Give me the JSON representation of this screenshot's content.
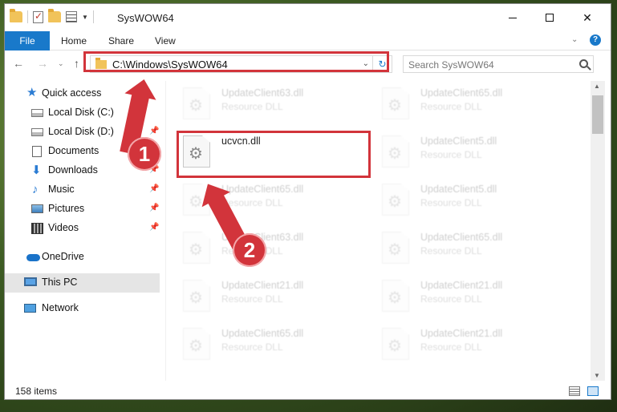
{
  "window": {
    "title": "SysWOW64"
  },
  "ribbon": {
    "tabs": [
      "File",
      "Home",
      "Share",
      "View"
    ],
    "help_label": "?"
  },
  "nav": {
    "address": "C:\\Windows\\SysWOW64",
    "search_placeholder": "Search SysWOW64"
  },
  "sidebar": {
    "items": [
      {
        "label": "Quick access",
        "icon": "star-icon"
      },
      {
        "label": "Local Disk (C:)",
        "icon": "disk-icon"
      },
      {
        "label": "Local Disk (D:)",
        "icon": "disk-icon"
      },
      {
        "label": "Documents",
        "icon": "documents-icon"
      },
      {
        "label": "Downloads",
        "icon": "download-icon"
      },
      {
        "label": "Music",
        "icon": "music-icon"
      },
      {
        "label": "Pictures",
        "icon": "pictures-icon"
      },
      {
        "label": "Videos",
        "icon": "videos-icon"
      },
      {
        "label": "OneDrive",
        "icon": "cloud-icon"
      },
      {
        "label": "This PC",
        "icon": "pc-icon"
      },
      {
        "label": "Network",
        "icon": "network-icon"
      }
    ]
  },
  "files": {
    "left": [
      {
        "name": "UpdateClient63.dll",
        "type": "Resource DLL"
      },
      {
        "name": "ucvcn.dll",
        "type": ""
      },
      {
        "name": "UpdateClient65.dll",
        "type": "Resource DLL"
      },
      {
        "name": "UpdateClient63.dll",
        "type": "Resource DLL"
      },
      {
        "name": "UpdateClient21.dll",
        "type": "Resource DLL"
      },
      {
        "name": "UpdateClient65.dll",
        "type": "Resource DLL"
      }
    ],
    "right": [
      {
        "name": "UpdateClient65.dll",
        "type": "Resource DLL"
      },
      {
        "name": "UpdateClient5.dll",
        "type": "Resource DLL"
      },
      {
        "name": "UpdateClient5.dll",
        "type": "Resource DLL"
      },
      {
        "name": "UpdateClient65.dll",
        "type": "Resource DLL"
      },
      {
        "name": "UpdateClient21.dll",
        "type": "Resource DLL"
      },
      {
        "name": "UpdateClient21.dll",
        "type": "Resource DLL"
      }
    ]
  },
  "status": {
    "item_count": "158 items"
  },
  "annotations": {
    "step1": "1",
    "step2": "2",
    "accent_color": "#d2343b"
  }
}
